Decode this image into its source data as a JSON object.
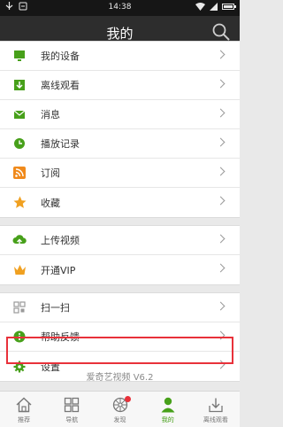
{
  "status_bar": {
    "time": "14:38"
  },
  "header": {
    "title": "我的"
  },
  "colors": {
    "accent_green": "#47a01a",
    "highlight_red": "#e8313a"
  },
  "groups": [
    [
      {
        "label": "我的设备",
        "icon": "monitor-icon"
      },
      {
        "label": "离线观看",
        "icon": "download-icon"
      },
      {
        "label": "消息",
        "icon": "envelope-icon"
      },
      {
        "label": "播放记录",
        "icon": "clock-icon"
      },
      {
        "label": "订阅",
        "icon": "rss-icon"
      },
      {
        "label": "收藏",
        "icon": "star-icon"
      }
    ],
    [
      {
        "label": "上传视频",
        "icon": "cloud-upload-icon"
      },
      {
        "label": "开通VIP",
        "icon": "crown-icon"
      }
    ],
    [
      {
        "label": "扫一扫",
        "icon": "qr-scan-icon"
      },
      {
        "label": "帮助反馈",
        "icon": "info-icon"
      },
      {
        "label": "设置",
        "icon": "gear-icon"
      }
    ]
  ],
  "version": "爱奇艺视频 V6.2",
  "tabs": [
    {
      "label": "推荐",
      "icon": "home-icon"
    },
    {
      "label": "导航",
      "icon": "grid-icon"
    },
    {
      "label": "发现",
      "icon": "compass-icon"
    },
    {
      "label": "我的",
      "icon": "user-icon"
    },
    {
      "label": "离线观看",
      "icon": "offline-download-icon"
    }
  ]
}
